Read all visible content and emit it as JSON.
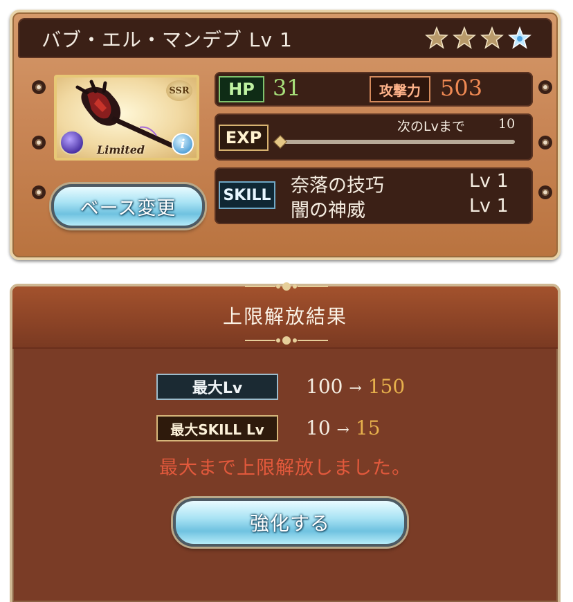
{
  "weapon": {
    "name_level": "バブ・エル・マンデブ Lv 1",
    "stars": 4,
    "rarity": "SSR",
    "badge": "Limited",
    "info_icon": "i",
    "base_change_button": "ベース変更"
  },
  "stats": {
    "hp_label": "HP",
    "hp_value": "31",
    "atk_label": "攻撃力",
    "atk_value": "503",
    "exp_label": "EXP",
    "next_lv_text": "次のLvまで",
    "next_lv_value": "10",
    "exp_progress": 0,
    "skill_label": "SKILL",
    "skills": [
      {
        "name": "奈落の技巧",
        "level": "Lv 1"
      },
      {
        "name": "闇の神威",
        "level": "Lv 1"
      }
    ]
  },
  "result": {
    "title": "上限解放結果",
    "max_lv_label": "最大Lv",
    "max_lv_from": "100",
    "max_lv_arrow": "→",
    "max_lv_to": "150",
    "max_skill_label": "最大SKILL Lv",
    "max_skill_from": "10",
    "max_skill_arrow": "→",
    "max_skill_to": "15",
    "message": "最大まで上限解放しました。",
    "enhance_button": "強化する"
  },
  "colors": {
    "panel_brown": "#7a3c26",
    "gold_text": "#e6b04c",
    "message_red": "#e2593c"
  }
}
